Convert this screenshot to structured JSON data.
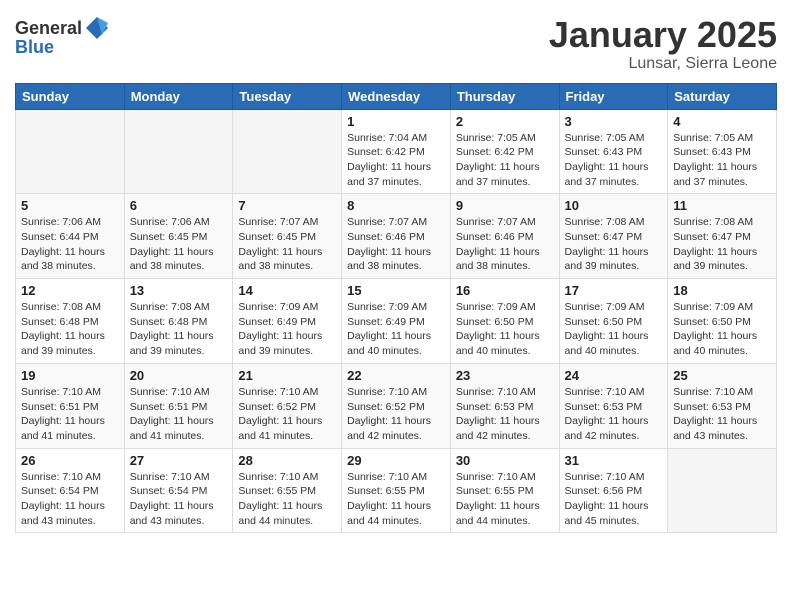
{
  "header": {
    "logo_general": "General",
    "logo_blue": "Blue",
    "month_title": "January 2025",
    "location": "Lunsar, Sierra Leone"
  },
  "days_of_week": [
    "Sunday",
    "Monday",
    "Tuesday",
    "Wednesday",
    "Thursday",
    "Friday",
    "Saturday"
  ],
  "weeks": [
    [
      {
        "day": "",
        "info": ""
      },
      {
        "day": "",
        "info": ""
      },
      {
        "day": "",
        "info": ""
      },
      {
        "day": "1",
        "info": "Sunrise: 7:04 AM\nSunset: 6:42 PM\nDaylight: 11 hours\nand 37 minutes."
      },
      {
        "day": "2",
        "info": "Sunrise: 7:05 AM\nSunset: 6:42 PM\nDaylight: 11 hours\nand 37 minutes."
      },
      {
        "day": "3",
        "info": "Sunrise: 7:05 AM\nSunset: 6:43 PM\nDaylight: 11 hours\nand 37 minutes."
      },
      {
        "day": "4",
        "info": "Sunrise: 7:05 AM\nSunset: 6:43 PM\nDaylight: 11 hours\nand 37 minutes."
      }
    ],
    [
      {
        "day": "5",
        "info": "Sunrise: 7:06 AM\nSunset: 6:44 PM\nDaylight: 11 hours\nand 38 minutes."
      },
      {
        "day": "6",
        "info": "Sunrise: 7:06 AM\nSunset: 6:45 PM\nDaylight: 11 hours\nand 38 minutes."
      },
      {
        "day": "7",
        "info": "Sunrise: 7:07 AM\nSunset: 6:45 PM\nDaylight: 11 hours\nand 38 minutes."
      },
      {
        "day": "8",
        "info": "Sunrise: 7:07 AM\nSunset: 6:46 PM\nDaylight: 11 hours\nand 38 minutes."
      },
      {
        "day": "9",
        "info": "Sunrise: 7:07 AM\nSunset: 6:46 PM\nDaylight: 11 hours\nand 38 minutes."
      },
      {
        "day": "10",
        "info": "Sunrise: 7:08 AM\nSunset: 6:47 PM\nDaylight: 11 hours\nand 39 minutes."
      },
      {
        "day": "11",
        "info": "Sunrise: 7:08 AM\nSunset: 6:47 PM\nDaylight: 11 hours\nand 39 minutes."
      }
    ],
    [
      {
        "day": "12",
        "info": "Sunrise: 7:08 AM\nSunset: 6:48 PM\nDaylight: 11 hours\nand 39 minutes."
      },
      {
        "day": "13",
        "info": "Sunrise: 7:08 AM\nSunset: 6:48 PM\nDaylight: 11 hours\nand 39 minutes."
      },
      {
        "day": "14",
        "info": "Sunrise: 7:09 AM\nSunset: 6:49 PM\nDaylight: 11 hours\nand 39 minutes."
      },
      {
        "day": "15",
        "info": "Sunrise: 7:09 AM\nSunset: 6:49 PM\nDaylight: 11 hours\nand 40 minutes."
      },
      {
        "day": "16",
        "info": "Sunrise: 7:09 AM\nSunset: 6:50 PM\nDaylight: 11 hours\nand 40 minutes."
      },
      {
        "day": "17",
        "info": "Sunrise: 7:09 AM\nSunset: 6:50 PM\nDaylight: 11 hours\nand 40 minutes."
      },
      {
        "day": "18",
        "info": "Sunrise: 7:09 AM\nSunset: 6:50 PM\nDaylight: 11 hours\nand 40 minutes."
      }
    ],
    [
      {
        "day": "19",
        "info": "Sunrise: 7:10 AM\nSunset: 6:51 PM\nDaylight: 11 hours\nand 41 minutes."
      },
      {
        "day": "20",
        "info": "Sunrise: 7:10 AM\nSunset: 6:51 PM\nDaylight: 11 hours\nand 41 minutes."
      },
      {
        "day": "21",
        "info": "Sunrise: 7:10 AM\nSunset: 6:52 PM\nDaylight: 11 hours\nand 41 minutes."
      },
      {
        "day": "22",
        "info": "Sunrise: 7:10 AM\nSunset: 6:52 PM\nDaylight: 11 hours\nand 42 minutes."
      },
      {
        "day": "23",
        "info": "Sunrise: 7:10 AM\nSunset: 6:53 PM\nDaylight: 11 hours\nand 42 minutes."
      },
      {
        "day": "24",
        "info": "Sunrise: 7:10 AM\nSunset: 6:53 PM\nDaylight: 11 hours\nand 42 minutes."
      },
      {
        "day": "25",
        "info": "Sunrise: 7:10 AM\nSunset: 6:53 PM\nDaylight: 11 hours\nand 43 minutes."
      }
    ],
    [
      {
        "day": "26",
        "info": "Sunrise: 7:10 AM\nSunset: 6:54 PM\nDaylight: 11 hours\nand 43 minutes."
      },
      {
        "day": "27",
        "info": "Sunrise: 7:10 AM\nSunset: 6:54 PM\nDaylight: 11 hours\nand 43 minutes."
      },
      {
        "day": "28",
        "info": "Sunrise: 7:10 AM\nSunset: 6:55 PM\nDaylight: 11 hours\nand 44 minutes."
      },
      {
        "day": "29",
        "info": "Sunrise: 7:10 AM\nSunset: 6:55 PM\nDaylight: 11 hours\nand 44 minutes."
      },
      {
        "day": "30",
        "info": "Sunrise: 7:10 AM\nSunset: 6:55 PM\nDaylight: 11 hours\nand 44 minutes."
      },
      {
        "day": "31",
        "info": "Sunrise: 7:10 AM\nSunset: 6:56 PM\nDaylight: 11 hours\nand 45 minutes."
      },
      {
        "day": "",
        "info": ""
      }
    ]
  ]
}
